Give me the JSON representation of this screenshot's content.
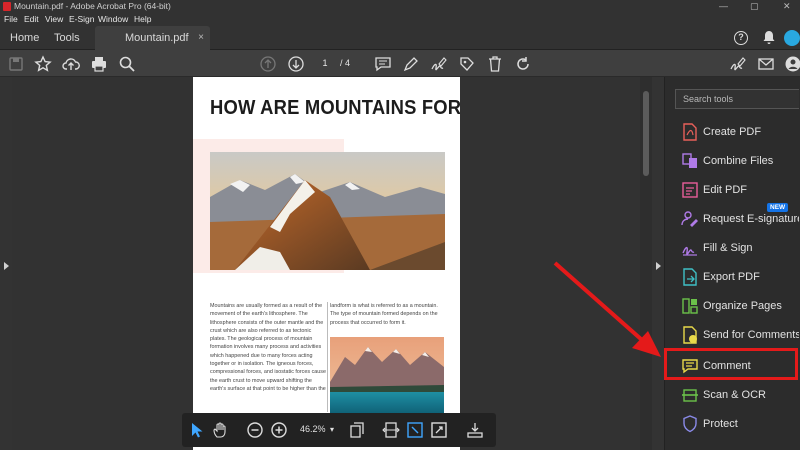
{
  "window": {
    "title": "Mountain.pdf - Adobe Acrobat Pro (64-bit)",
    "minimize": "—",
    "maximize": "▢",
    "close": "✕"
  },
  "menu": [
    "File",
    "Edit",
    "View",
    "E-Sign",
    "Window",
    "Help"
  ],
  "tabs": {
    "home": "Home",
    "tools": "Tools",
    "document": "Mountain.pdf",
    "close": "×"
  },
  "toolbar": {
    "current_page": "1",
    "page_total": "/ 4"
  },
  "page": {
    "title": "HOW ARE MOUNTAINS FORMED?",
    "col1": "Mountains are usually formed as a result of the movement of the earth's lithosphere. The lithosphere consists of the outer mantle and the crust which are also referred to as tectonic plates. The geological process of mountain formation involves many process and activities which happened due to many forces acting together or in isolation. The igneous forces, compressional forces, and isostatic forces cause the earth crust to move upward shifting the earth's surface at that point to be higher than the",
    "col2": "landform is what is referred to as a mountain. The type of mountain formed depends on the process that occurred to form it."
  },
  "floatbar": {
    "zoom": "46.2%",
    "dropdown": "▾"
  },
  "tools_panel": {
    "search_placeholder": "Search tools",
    "items": [
      {
        "label": "Create PDF",
        "color": "#e8605a"
      },
      {
        "label": "Combine Files",
        "color": "#b07be8"
      },
      {
        "label": "Edit PDF",
        "color": "#e85e9a"
      },
      {
        "label": "Request E-signatures",
        "color": "#b07be8",
        "badge": "NEW"
      },
      {
        "label": "Fill & Sign",
        "color": "#b07be8"
      },
      {
        "label": "Export PDF",
        "color": "#3fc0c6"
      },
      {
        "label": "Organize Pages",
        "color": "#6bc24a"
      },
      {
        "label": "Send for Comments",
        "color": "#e8d94a"
      },
      {
        "label": "Comment",
        "color": "#e8d94a"
      },
      {
        "label": "Scan & OCR",
        "color": "#6bc24a"
      },
      {
        "label": "Protect",
        "color": "#8a8ae8"
      }
    ]
  },
  "colors": {
    "highlight": "#e41a1a",
    "accent": "#1473e6"
  }
}
